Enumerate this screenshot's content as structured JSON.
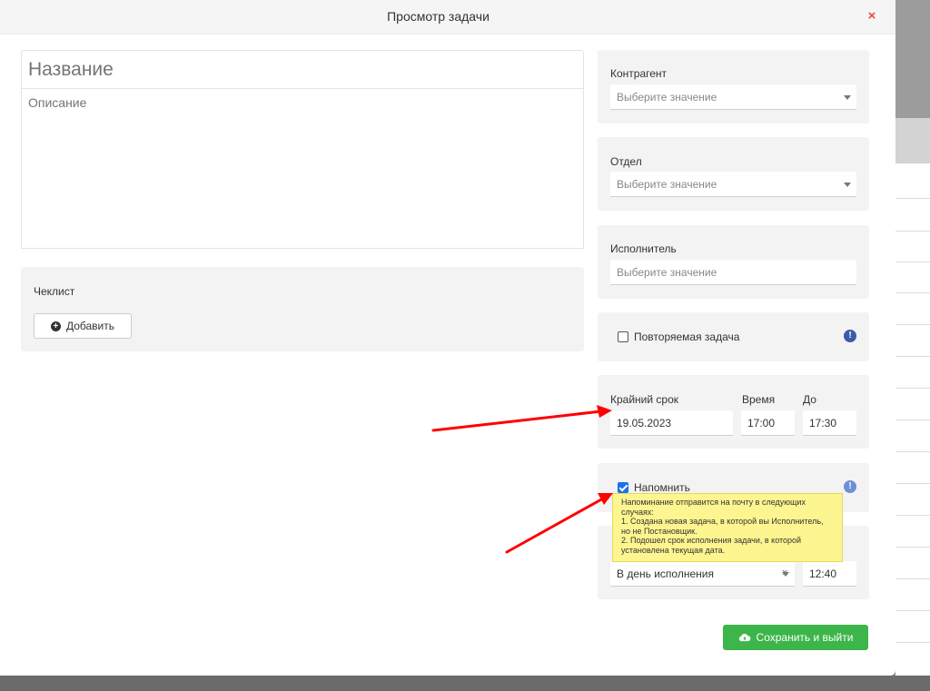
{
  "modal": {
    "title": "Просмотр задачи",
    "close": "×"
  },
  "task": {
    "title_placeholder": "Название",
    "description_placeholder": "Описание"
  },
  "checklist": {
    "label": "Чеклист",
    "add_label": "Добавить"
  },
  "contractor": {
    "label": "Контрагент",
    "placeholder": "Выберите значение"
  },
  "department": {
    "label": "Отдел",
    "placeholder": "Выберите значение"
  },
  "executor": {
    "label": "Исполнитель",
    "placeholder": "Выберите значение"
  },
  "recurring": {
    "label": "Повторяемая задача",
    "checked": false,
    "info": "!"
  },
  "deadline": {
    "date_label": "Крайний срок",
    "date_value": "19.05.2023",
    "time_label": "Время",
    "time_value": "17:00",
    "until_label": "До",
    "until_value": "17:30"
  },
  "reminder": {
    "label": "Напомнить",
    "checked": true,
    "info": "!",
    "tooltip": "Напоминание отправится на почту в следующих случаях:\n1. Создана новая задача, в которой вы Исполнитель, но не Постановщик.\n2. Подошел срок исполнения задачи, в которой установлена текущая дата.",
    "when_value": "В день исполнения",
    "clear": "×",
    "time_value": "12:40"
  },
  "save_label": "Сохранить и выйти",
  "colors": {
    "accent_green": "#3cb54a",
    "close_red": "#e74c3c",
    "annotation_red": "#ff0000",
    "tooltip_yellow": "#fdf58f",
    "info_blue": "#3b5ba9"
  }
}
